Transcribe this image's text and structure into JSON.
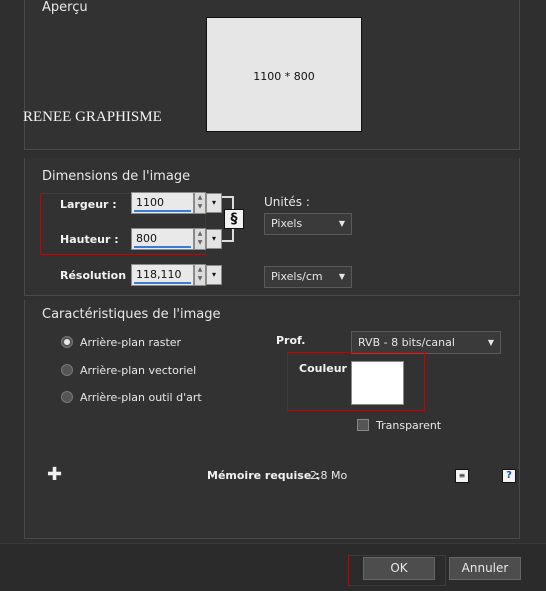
{
  "preview": {
    "title": "Aperçu",
    "canvas_text": "1100 * 800",
    "watermark": "RENEE GRAPHISME"
  },
  "dimensions": {
    "title": "Dimensions de l'image",
    "width_label": "Largeur :",
    "width_value": "1100",
    "height_label": "Hauteur :",
    "height_value": "800",
    "resolution_label": "Résolution :",
    "resolution_value": "118,110",
    "units_label": "Unités :",
    "units_value": "Pixels",
    "resolution_unit_value": "Pixels/cm"
  },
  "characteristics": {
    "title": "Caractéristiques de l'image",
    "options": [
      "Arrière-plan raster",
      "Arrière-plan vectoriel",
      "Arrière-plan outil d'art"
    ],
    "selected": "Arrière-plan raster",
    "depth_label": "Prof.",
    "depth_value": "RVB - 8 bits/canal",
    "color_label": "Couleur :",
    "color_value": "#ffffff",
    "transparent_label": "Transparent",
    "transparent_checked": false
  },
  "footer": {
    "memory_label": "Mémoire requise :",
    "memory_value": "2,8 Mo",
    "ok_label": "OK",
    "cancel_label": "Annuler"
  },
  "colors": {
    "dialog_bg": "#2f2f2f",
    "highlight_red": "#8b1a1a",
    "input_underline": "#3a7bd5"
  }
}
